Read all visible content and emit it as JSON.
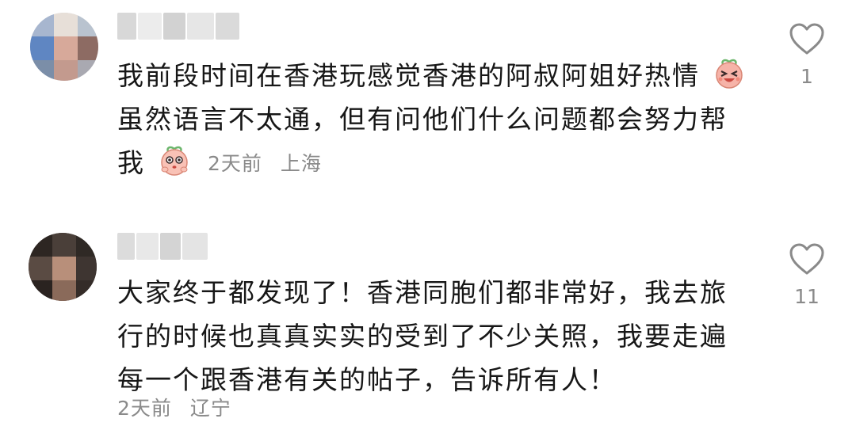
{
  "comments": [
    {
      "text_lines": [
        "我前段时间在香港玩感觉香港的阿叔阿姐好热情",
        "虽然语言不太通，但有问他们什么问题都会努力帮",
        "我"
      ],
      "time": "2天前",
      "location": "上海",
      "likes": "1"
    },
    {
      "text_lines": [
        "大家终于都发现了！香港同胞们都非常好，我去旅",
        "行的时候也真真实实的受到了不少关照，我要走遍",
        "每一个跟香港有关的帖子，告诉所有人！"
      ],
      "time": "2天前",
      "location": "辽宁",
      "likes": "11"
    }
  ],
  "icons": {
    "like": "heart-outline-icon",
    "emoji_laugh": "laughing-peach-emoji-icon",
    "emoji_shy": "shy-peach-emoji-icon"
  },
  "colors": {
    "text": "#171717",
    "meta": "#8a8a8a",
    "emoji_pink": "#f6b3a8"
  }
}
